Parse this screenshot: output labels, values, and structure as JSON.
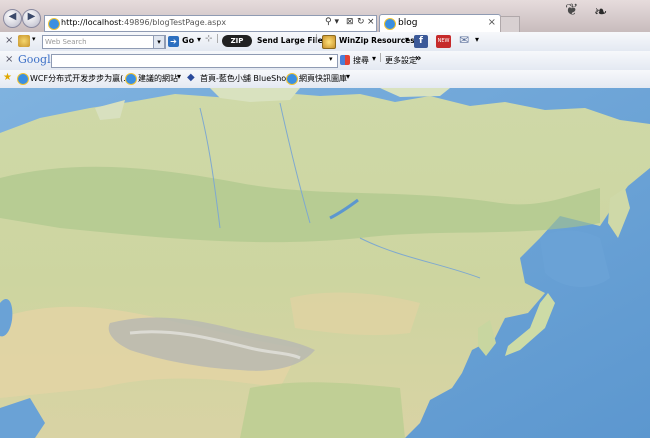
{
  "browser": {
    "url_host": "http://localhost",
    "url_rest": ":49896/blogTestPage.aspx",
    "tab_title": "blog",
    "tab_close": "×",
    "addr_controls": [
      "⚲ ▾",
      "⊠",
      "↻",
      "×"
    ]
  },
  "toolbar1": {
    "close": "×",
    "search_placeholder": "Web Search",
    "go_label": "Go",
    "send_large_files": "Send Large Files",
    "winzip_resources": "WinZip Resources",
    "zip_logo": "ZIP",
    "news_badge": "NEW"
  },
  "toolbar2": {
    "close": "×",
    "google_label": "Google",
    "search_label": "搜尋",
    "more_settings": "更多設定",
    "more_arrow": "»"
  },
  "favorites": {
    "items": [
      {
        "label": "WCF分布式开发步步为赢(..."
      },
      {
        "label": "建議的網站"
      },
      {
        "label": "首頁-藍色小舖 BlueShop"
      },
      {
        "label": "網頁快訊圖庫"
      }
    ]
  },
  "map": {
    "ocean_color": "#6aa2d6",
    "land_color": "#c9d89e"
  }
}
